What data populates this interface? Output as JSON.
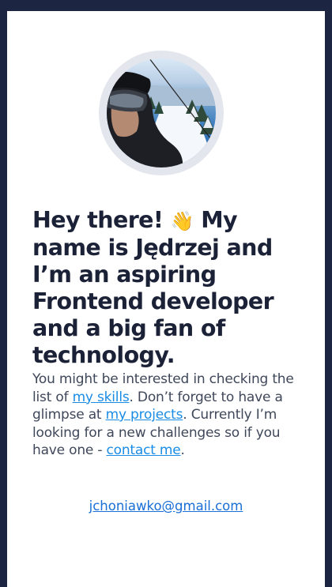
{
  "hero": {
    "avatar_alt": "Profile photo on a ski slope",
    "headline_before_emoji": "Hey there!",
    "wave_emoji": "👋",
    "headline_after_emoji": " My name is Jędrzej and I’m an aspiring Frontend developer and a big fan of technology."
  },
  "intro": {
    "part1": "You might be interested in checking the list of ",
    "skills_link": "my skills",
    "part2": ". Don’t forget to have a glimpse at ",
    "projects_link": "my projects",
    "part3": ". Currently I’m looking for a new challenges so if you have one - ",
    "contact_link": "contact me",
    "part4": "."
  },
  "contact": {
    "email": "jchoniawko@gmail.com"
  },
  "colors": {
    "background": "#1c2541",
    "card": "#ffffff",
    "heading": "#1b2136",
    "link": "#1a8ce5"
  }
}
